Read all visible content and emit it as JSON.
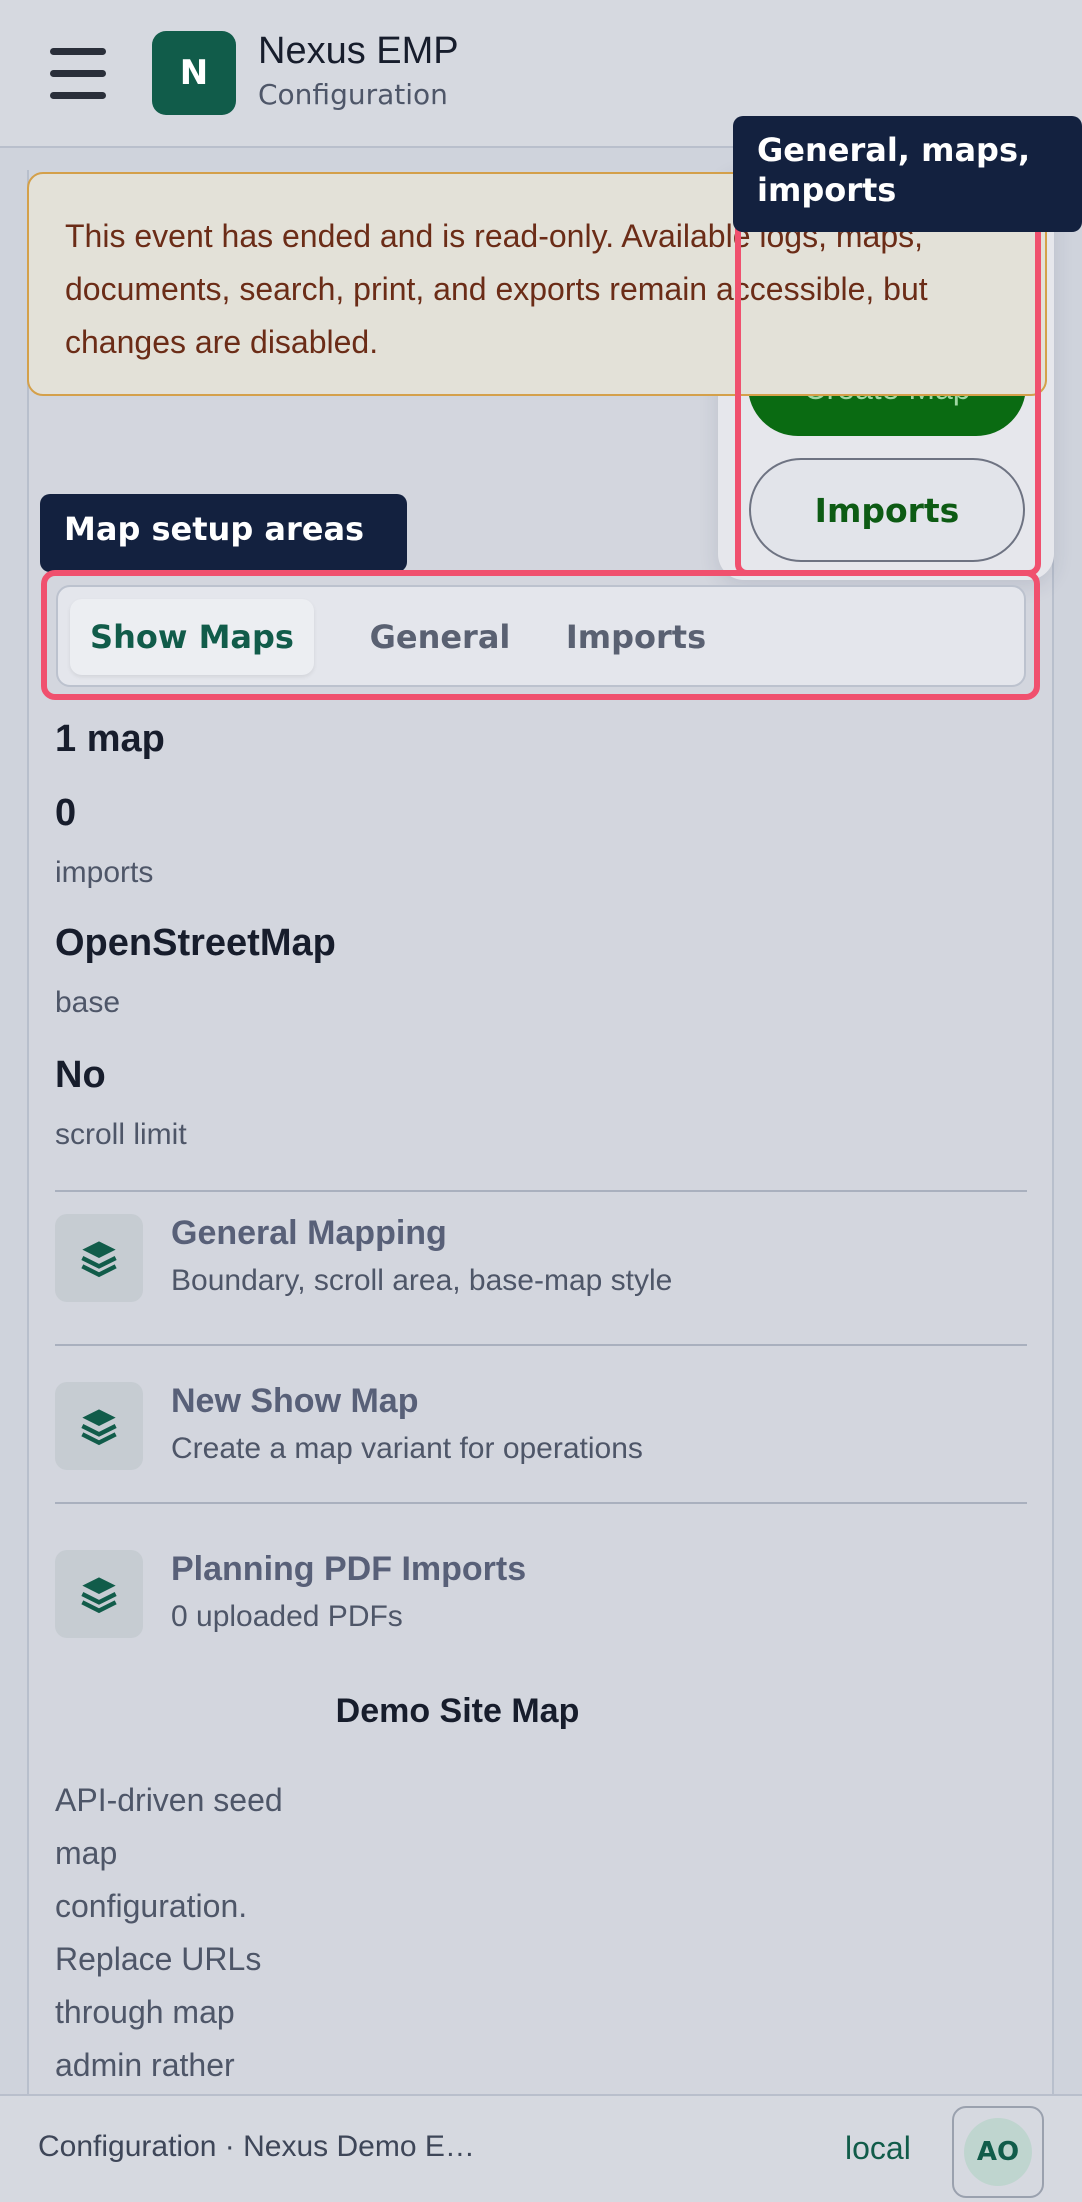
{
  "header": {
    "menu_icon": "hamburger-icon",
    "logo_letter": "N",
    "app_name": "Nexus EMP",
    "subtitle": "Configuration"
  },
  "banner": {
    "text": "This event has ended and is read-only. Available logs, maps, documents, search, print, and exports remain accessible, but changes are disabled."
  },
  "actions": {
    "create_map_label": "Create Map",
    "imports_label": "Imports"
  },
  "tooltips": {
    "right": "General, maps, imports",
    "left": "Map setup areas"
  },
  "tabs": [
    {
      "label": "Show Maps",
      "active": true
    },
    {
      "label": "General",
      "active": false
    },
    {
      "label": "Imports",
      "active": false
    }
  ],
  "stats": {
    "maps_count": "1 map",
    "imports_value": "0",
    "imports_label": "imports",
    "base_value": "OpenStreetMap",
    "base_label": "base",
    "scroll_value": "No",
    "scroll_label": "scroll limit"
  },
  "list": [
    {
      "icon": "layers-icon",
      "title": "General Mapping",
      "subtitle": "Boundary, scroll area, base-map style"
    },
    {
      "icon": "layers-icon",
      "title": "New Show Map",
      "subtitle": "Create a map variant for operations"
    },
    {
      "icon": "layers-icon",
      "title": "Planning PDF Imports",
      "subtitle": "0 uploaded PDFs"
    }
  ],
  "demo": {
    "title": "Demo Site Map",
    "description": "API-driven seed map configuration. Replace URLs through map admin rather"
  },
  "footer": {
    "context": "Configuration · Nexus Demo E…",
    "environment": "local",
    "avatar_initials": "AO"
  },
  "colors": {
    "brand": "#115c4a",
    "highlight": "#f0506e",
    "tooltip_bg": "#13213f",
    "primary_button": "#0a6b12"
  }
}
